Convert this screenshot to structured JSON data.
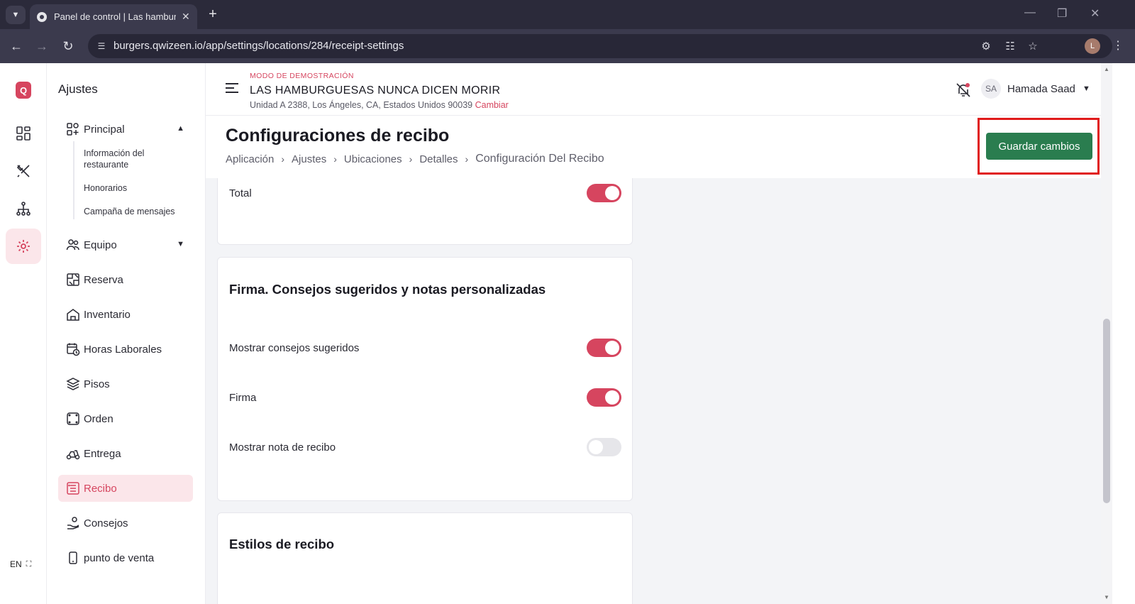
{
  "browser": {
    "tab_title": "Panel de control | Las hamburguesas",
    "url": "burgers.qwizeen.io/app/settings/locations/284/receipt-settings",
    "profile_initial": "L"
  },
  "rail": {
    "logo": "Q",
    "language": "EN"
  },
  "sidenav": {
    "title": "Ajustes",
    "principal": "Principal",
    "sub_items": [
      "Información del restaurante",
      "Honorarios",
      "Campaña de mensajes"
    ],
    "items": [
      {
        "label": "Equipo",
        "icon": "team-icon"
      },
      {
        "label": "Reserva",
        "icon": "reservation-icon"
      },
      {
        "label": "Inventario",
        "icon": "inventory-icon"
      },
      {
        "label": "Horas Laborales",
        "icon": "calendar-clock-icon"
      },
      {
        "label": "Pisos",
        "icon": "layers-icon"
      },
      {
        "label": "Orden",
        "icon": "order-icon"
      },
      {
        "label": "Entrega",
        "icon": "delivery-icon"
      },
      {
        "label": "Recibo",
        "icon": "receipt-icon"
      },
      {
        "label": "Consejos",
        "icon": "tips-icon"
      },
      {
        "label": "punto de venta",
        "icon": "pos-icon"
      }
    ]
  },
  "header": {
    "demo_label": "MODO DE DEMOSTRACIÓN",
    "restaurant_name": "LAS HAMBURGUESAS NUNCA DICEN MORIR",
    "address": "Unidad A 2388, Los Ángeles, CA, Estados Unidos 90039",
    "change_link": "Cambiar",
    "user_initials": "SA",
    "user_name": "Hamada Saad"
  },
  "page": {
    "title": "Configuraciones de recibo",
    "breadcrumbs": [
      "Aplicación",
      "Ajustes",
      "Ubicaciones",
      "Detalles",
      "Configuración Del Recibo"
    ],
    "save_label": "Guardar cambios"
  },
  "cards": {
    "total": {
      "label": "Total",
      "on": true
    },
    "signature": {
      "title": "Firma. Consejos sugeridos y notas personalizadas",
      "rows": [
        {
          "label": "Mostrar consejos sugeridos",
          "on": true
        },
        {
          "label": "Firma",
          "on": true
        },
        {
          "label": "Mostrar nota de recibo",
          "on": false
        }
      ]
    },
    "styles": {
      "title": "Estilos de recibo"
    }
  },
  "colors": {
    "accent": "#d6455f",
    "save_button": "#2a7d4f",
    "highlight_frame": "#e01a1a"
  }
}
